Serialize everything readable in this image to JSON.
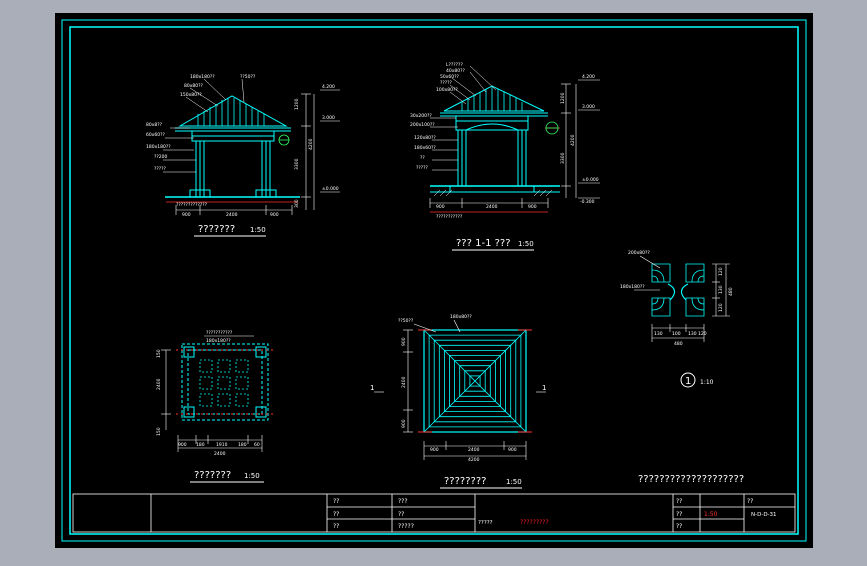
{
  "colors": {
    "background": "#a9aeb8",
    "sheet": "#000000",
    "frame": "#00ffff",
    "structure": "#00ffff",
    "dimension": "#ffffff",
    "leader": "#ffffff",
    "accent_red": "#ff3030",
    "label": "#ffffff",
    "title_red": "#ff2020",
    "green": "#33ff66"
  },
  "views": {
    "front_elevation": {
      "title": "??????? ",
      "scale": "1:50",
      "callouts": [
        "180x180??",
        "??50??",
        "80x80??",
        "150x80??",
        "80x8??",
        "60x60??",
        "180x180??",
        "??200",
        "?????"
      ],
      "levels": [
        "4.200",
        "3.000",
        "±0.000"
      ],
      "side_dims": [
        "1200",
        "4200",
        "3300",
        "300"
      ],
      "bottom_note": "?????????????",
      "bottom_dims": [
        "900",
        "2400",
        "900"
      ]
    },
    "section": {
      "title": "??? 1-1 ???",
      "scale": "1:50",
      "callouts": [
        "L??????",
        "40x80??",
        "50x60??",
        "?????",
        "100x80??",
        "30x200??",
        "200x100??",
        "120x80??",
        "180x60??",
        "??",
        "?????"
      ],
      "levels": [
        "4.200",
        "3.000",
        "±0.000",
        "-0.300"
      ],
      "side_dims": [
        "1200",
        "4200",
        "3300"
      ],
      "bottom_note": "???????????",
      "bottom_dims": [
        "900",
        "2400",
        "900"
      ]
    },
    "plan": {
      "title": "???????",
      "scale": "1:50",
      "top_note": "???????????",
      "callout": "180x180??",
      "left_dims": [
        "150",
        "2400",
        "150"
      ],
      "bottom_dims": [
        "900",
        "180",
        "1910",
        "180",
        "60"
      ],
      "bottom_total": "2400"
    },
    "roof_plan": {
      "title": "????????",
      "scale": "1:50",
      "callouts": [
        "??50??",
        "180x80??"
      ],
      "left_dims": [
        "900",
        "2400",
        "900"
      ],
      "bottom_dims": [
        "900",
        "2400",
        "900"
      ],
      "bottom_total": "4200",
      "section_mark": "1"
    },
    "detail": {
      "marker": "1",
      "scale": "1:10",
      "callouts": [
        "200x80??",
        "180x180??"
      ],
      "right_dims": [
        "120",
        "130",
        "120",
        "480"
      ],
      "bottom_dims": [
        "130",
        "100",
        "130",
        "120"
      ],
      "bottom_total": "480"
    },
    "note": "????????????????????"
  },
  "title_block": {
    "row1": [
      "??",
      "???"
    ],
    "row2": [
      "??",
      "??"
    ],
    "row3": [
      "??",
      "?????"
    ],
    "drawing_name": "?????????",
    "project_label": "??",
    "scale_label": "??",
    "scale_value": "1:50",
    "date_label": "??",
    "sheet_label": "??",
    "sheet_number": "N-D-D-31",
    "sheet_no_label": "?????"
  }
}
